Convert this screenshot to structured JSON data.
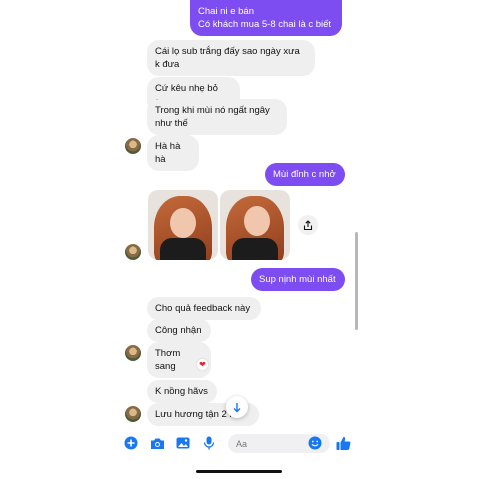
{
  "colors": {
    "accent": "#7d4df2",
    "incoming": "#efeff0",
    "action_blue": "#1877f2",
    "heart": "#e3263b"
  },
  "messages": [
    {
      "dir": "out",
      "text": "Chai ni e bán\nCó khách mua 5-8 chai là c biết"
    },
    {
      "dir": "in",
      "text": "Cái lọ sub trắng đấy sao ngày xưa\nk đưa"
    },
    {
      "dir": "in",
      "text": "Cứ kêu nhẹ bỏ qua"
    },
    {
      "dir": "in",
      "text": "Trong khi mùi nó ngất ngây\nnhư thế"
    },
    {
      "dir": "in",
      "text": "Hà hà hà"
    },
    {
      "dir": "out",
      "text": "Mùi đỉnh c nhở"
    },
    {
      "dir": "out",
      "text": "Sup nịnh mùi nhất"
    },
    {
      "dir": "in",
      "text": "Cho quả feedback này"
    },
    {
      "dir": "in",
      "text": "Công nhận"
    },
    {
      "dir": "in",
      "text": "Thơm sang"
    },
    {
      "dir": "in",
      "text": "K nồng hãvs"
    },
    {
      "dir": "in",
      "text": "Lưu hương tận 2  h"
    }
  ],
  "reaction": {
    "icon": "heart-icon",
    "glyph": "❤"
  },
  "photos": [
    {
      "icon": "photo-woman"
    },
    {
      "icon": "photo-woman"
    }
  ],
  "composer": {
    "placeholder": "Aa",
    "icons": [
      "plus-icon",
      "camera-icon",
      "gallery-icon",
      "microphone-icon",
      "emoji-icon",
      "thumbs-up-icon"
    ]
  }
}
